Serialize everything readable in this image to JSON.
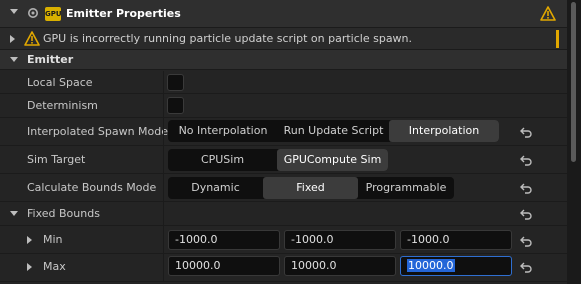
{
  "header": {
    "title": "Emitter Properties",
    "badge": "GPU"
  },
  "warning": {
    "text": "GPU is incorrectly running particle update script on particle spawn."
  },
  "emitter_section": {
    "label": "Emitter",
    "local_space": {
      "label": "Local Space",
      "checked": false
    },
    "determinism": {
      "label": "Determinism",
      "checked": false
    },
    "interpolated_spawn": {
      "label": "Interpolated Spawn Mode",
      "options": [
        "No Interpolation",
        "Run Update Script",
        "Interpolation"
      ],
      "selected": "Interpolation"
    },
    "sim_target": {
      "label": "Sim Target",
      "options": [
        "CPUSim",
        "GPUCompute Sim"
      ],
      "selected": "GPUCompute Sim"
    },
    "calc_bounds": {
      "label": "Calculate Bounds Mode",
      "options": [
        "Dynamic",
        "Fixed",
        "Programmable"
      ],
      "selected": "Fixed"
    }
  },
  "fixed_bounds": {
    "label": "Fixed Bounds",
    "min": {
      "label": "Min",
      "x": "-1000.0",
      "y": "-1000.0",
      "z": "-1000.0"
    },
    "max": {
      "label": "Max",
      "x": "10000.0",
      "y": "10000.0",
      "z": "10000.0"
    }
  },
  "colors": {
    "accent": "#e2a800",
    "selection": "#2466d8",
    "panel_bg": "#242424"
  }
}
